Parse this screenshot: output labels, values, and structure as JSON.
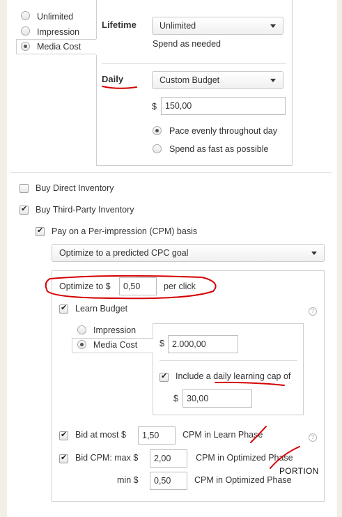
{
  "budget_type": {
    "options": [
      "Unlimited",
      "Impression",
      "Media Cost"
    ],
    "selected": "Media Cost"
  },
  "budget": {
    "lifetime_label": "Lifetime",
    "lifetime_select": "Unlimited",
    "lifetime_note": "Spend as needed",
    "daily_label": "Daily",
    "daily_select": "Custom Budget",
    "currency": "$",
    "daily_amount": "150,00",
    "pacing_options": [
      "Pace evenly throughout day",
      "Spend as fast as possible"
    ],
    "pacing_selected": "Pace evenly throughout day"
  },
  "inventory": {
    "buy_direct": "Buy Direct Inventory",
    "buy_third_party": "Buy Third-Party Inventory",
    "pay_cpm": "Pay on a Per-impression (CPM) basis",
    "optimize_select": "Optimize to a predicted CPC goal"
  },
  "optimization": {
    "optimize_prefix": "Optimize to $",
    "optimize_value": "0,50",
    "optimize_suffix": "per click",
    "learn_budget_label": "Learn Budget",
    "learn_options": [
      "Impression",
      "Media Cost"
    ],
    "learn_selected": "Media Cost",
    "currency": "$",
    "learn_amount": "2.000,00",
    "daily_cap_label": "Include a daily learning cap of",
    "daily_cap_amount": "30,00",
    "help_glyph": "?"
  },
  "bidding": {
    "bid_at_most_label": "Bid at most $",
    "bid_at_most_value": "1,50",
    "bid_at_most_suffix": "CPM in Learn Phase",
    "bid_cpm_label": "Bid CPM: max $",
    "bid_cpm_max_value": "2,00",
    "bid_cpm_max_suffix": "CPM in Optimized Phase",
    "min_label": "min $",
    "min_value": "0,50",
    "min_suffix": "CPM in Optimized Phase"
  },
  "annotation": {
    "handwritten_note": "PORTION",
    "ink_color": "#d40000"
  }
}
